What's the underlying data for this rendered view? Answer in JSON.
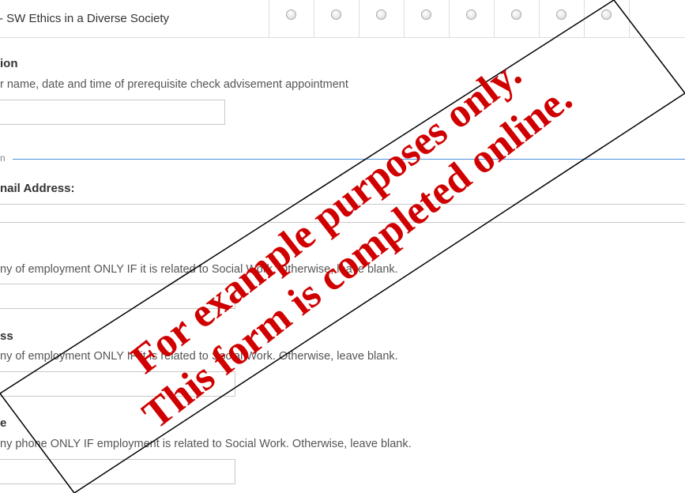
{
  "course": {
    "name": "- SW Ethics in a Diverse Society",
    "radio_count": 8
  },
  "advisement": {
    "label": "ion",
    "help": "r name, date and time of prerequisite check advisement appointment",
    "value": ""
  },
  "section_divider": {
    "label": "n"
  },
  "email": {
    "label": "nail Address:",
    "value": ""
  },
  "employment": {
    "help": "ny of employment ONLY IF it is related to Social Work. Otherwise, leave blank.",
    "value": ""
  },
  "address": {
    "label": "ss",
    "help": "ny of employment ONLY IF it is related to Social Work. Otherwise, leave blank.",
    "value": ""
  },
  "phone": {
    "label": "e",
    "help": "ny phone ONLY IF employment is related to Social Work. Otherwise, leave blank.",
    "value": ""
  },
  "watermark": {
    "line1": "For example purposes only.",
    "line2": "This form is completed online.",
    "color": "#d00000"
  }
}
